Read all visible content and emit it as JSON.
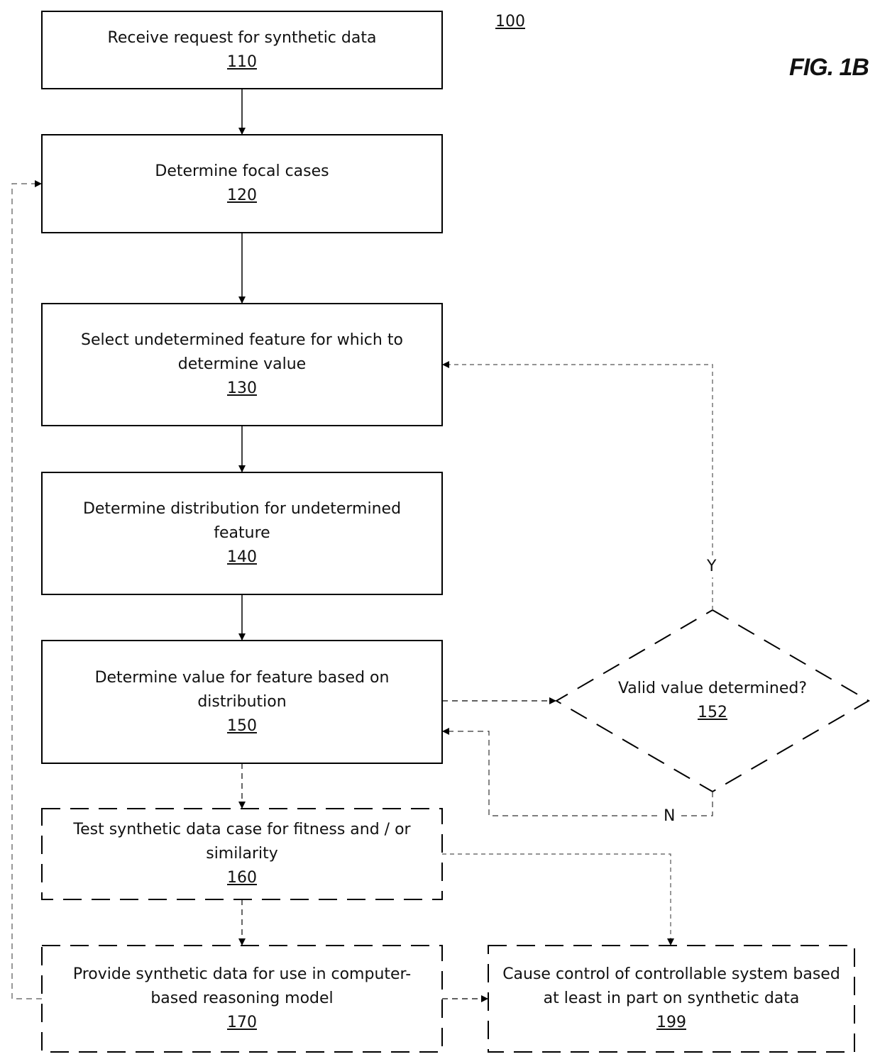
{
  "figure": {
    "label": "FIG. 1B",
    "ref": "100"
  },
  "steps": [
    {
      "id": "110",
      "text": "Receive request for synthetic data",
      "style": "solid"
    },
    {
      "id": "120",
      "text": "Determine focal cases",
      "style": "solid"
    },
    {
      "id": "130",
      "text": "Select undetermined feature for which to determine value",
      "style": "solid"
    },
    {
      "id": "140",
      "text": "Determine distribution for undetermined feature",
      "style": "solid"
    },
    {
      "id": "150",
      "text": "Determine value for feature based on distribution",
      "style": "solid"
    },
    {
      "id": "160",
      "text": "Test synthetic data case for fitness and / or similarity",
      "style": "dashed"
    },
    {
      "id": "170",
      "text": "Provide synthetic data for use in computer-based reasoning model",
      "style": "dashed"
    },
    {
      "id": "199",
      "text": "Cause control of controllable system based at least in part on synthetic data",
      "style": "dashed"
    }
  ],
  "decision": {
    "id": "152",
    "text": "Valid value determined?",
    "yes_label": "Y",
    "no_label": "N"
  }
}
